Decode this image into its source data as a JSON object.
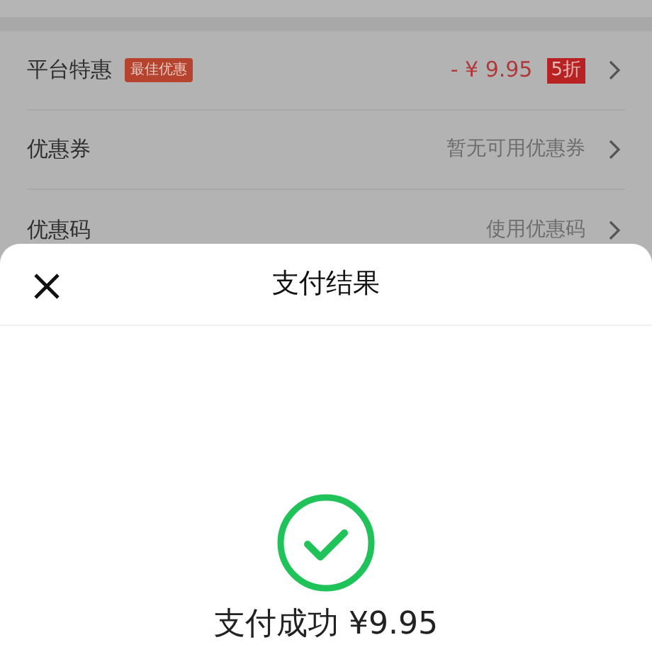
{
  "discount_rows": [
    {
      "kind": "promo",
      "label": "平台特惠",
      "badge": "最佳优惠",
      "amount": "- ¥ 9.95",
      "discount_tag": "5折"
    },
    {
      "kind": "plain",
      "label": "优惠券",
      "value": "暂无可用优惠券"
    },
    {
      "kind": "plain",
      "label": "优惠码",
      "value": "使用优惠码"
    }
  ],
  "result_sheet": {
    "title": "支付结果",
    "message": "支付成功 ¥9.95"
  }
}
